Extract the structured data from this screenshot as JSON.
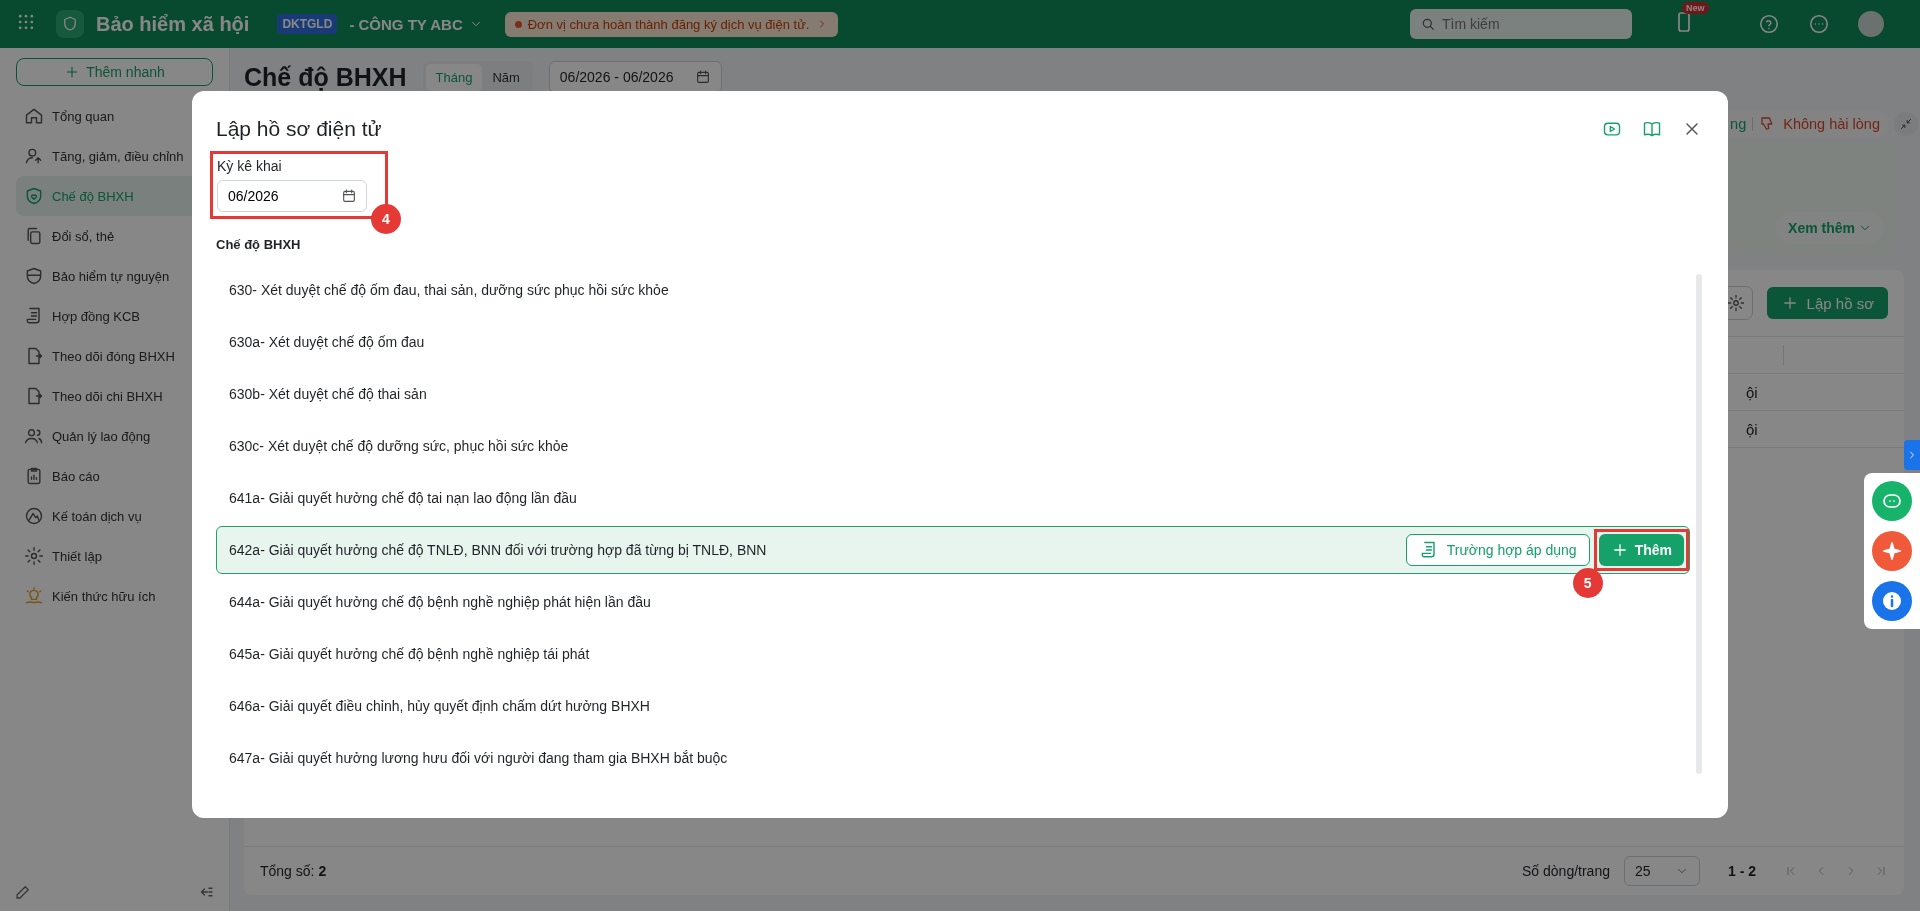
{
  "header": {
    "app_title": "Bảo hiểm xã hội",
    "unit_code": "DKTGLD",
    "company": "- CÔNG TY ABC",
    "notice": "Đơn vị chưa hoàn thành đăng ký dịch vụ điện tử.",
    "search": {
      "placeholder": "Tìm kiếm"
    },
    "new_badge": "New"
  },
  "sidebar": {
    "quick_add": "Thêm nhanh",
    "items": [
      {
        "label": "Tổng quan",
        "selected": false
      },
      {
        "label": "Tăng, giảm, điều chỉnh",
        "selected": false
      },
      {
        "label": "Chế độ BHXH",
        "selected": true
      },
      {
        "label": "Đổi sổ, thẻ",
        "selected": false
      },
      {
        "label": "Bảo hiểm tự nguyện",
        "selected": false
      },
      {
        "label": "Hợp đồng KCB",
        "selected": false
      },
      {
        "label": "Theo dõi đóng BHXH",
        "selected": false
      },
      {
        "label": "Theo dõi chi BHXH",
        "selected": false
      },
      {
        "label": "Quản lý lao động",
        "selected": false
      },
      {
        "label": "Báo cáo",
        "selected": false
      },
      {
        "label": "Kế toán dịch vụ",
        "selected": false
      },
      {
        "label": "Thiết lập",
        "selected": false
      },
      {
        "label": "Kiến thức hữu ích",
        "selected": false
      }
    ]
  },
  "page": {
    "title": "Chế độ BHXH",
    "period_tabs": [
      {
        "label": "Tháng",
        "selected": true
      },
      {
        "label": "Năm",
        "selected": false
      }
    ],
    "date_range": "06/2026 - 06/2026",
    "feedback": [
      {
        "label": "ng",
        "kind": "positive"
      },
      {
        "label": "Không hài lòng",
        "kind": "negative"
      }
    ],
    "see_more": "Xem thêm",
    "create_button": "Lập hồ sơ",
    "table_rows": [
      {
        "cell": "ội"
      },
      {
        "cell": "ội"
      }
    ],
    "footer": {
      "total": "Tổng số: **2**",
      "rows_per_page_label": "Số dòng/trang",
      "rows_per_page": "25",
      "range": "1 - 2"
    }
  },
  "modal": {
    "title": "Lập hồ sơ điện tử",
    "period": {
      "label": "Kỳ kê khai",
      "value": "06/2026",
      "callout": "4"
    },
    "section_label": "Chế độ BHXH",
    "apply_button": "Trường hợp áp dụng",
    "add_button": "Thêm",
    "add_callout": "5",
    "items": [
      {
        "label": "630- Xét duyệt chế độ ốm đau, thai sản, dưỡng sức phục hồi sức khỏe",
        "selected": false
      },
      {
        "label": "630a- Xét duyệt chế độ ốm đau",
        "selected": false
      },
      {
        "label": "630b- Xét duyệt chế độ thai sản",
        "selected": false
      },
      {
        "label": "630c- Xét duyệt chế độ dưỡng sức, phục hồi sức khỏe",
        "selected": false
      },
      {
        "label": "641a- Giải quyết hưởng chế độ tai nạn lao động lần đầu",
        "selected": false
      },
      {
        "label": "642a- Giải quyết hưởng chế độ TNLĐ, BNN đối với trường hợp đã từng bị TNLĐ, BNN",
        "selected": true
      },
      {
        "label": "644a- Giải quyết hưởng chế độ bệnh nghề nghiệp phát hiện lần đầu",
        "selected": false
      },
      {
        "label": "645a- Giải quyết hưởng chế độ bệnh nghề nghiệp tái phát",
        "selected": false
      },
      {
        "label": "646a- Giải quyết điều chỉnh, hủy quyết định chấm dứt hưởng BHXH",
        "selected": false
      },
      {
        "label": "647a- Giải quyết hưởng lương hưu đối với người đang tham gia BHXH bắt buộc",
        "selected": false
      }
    ]
  }
}
